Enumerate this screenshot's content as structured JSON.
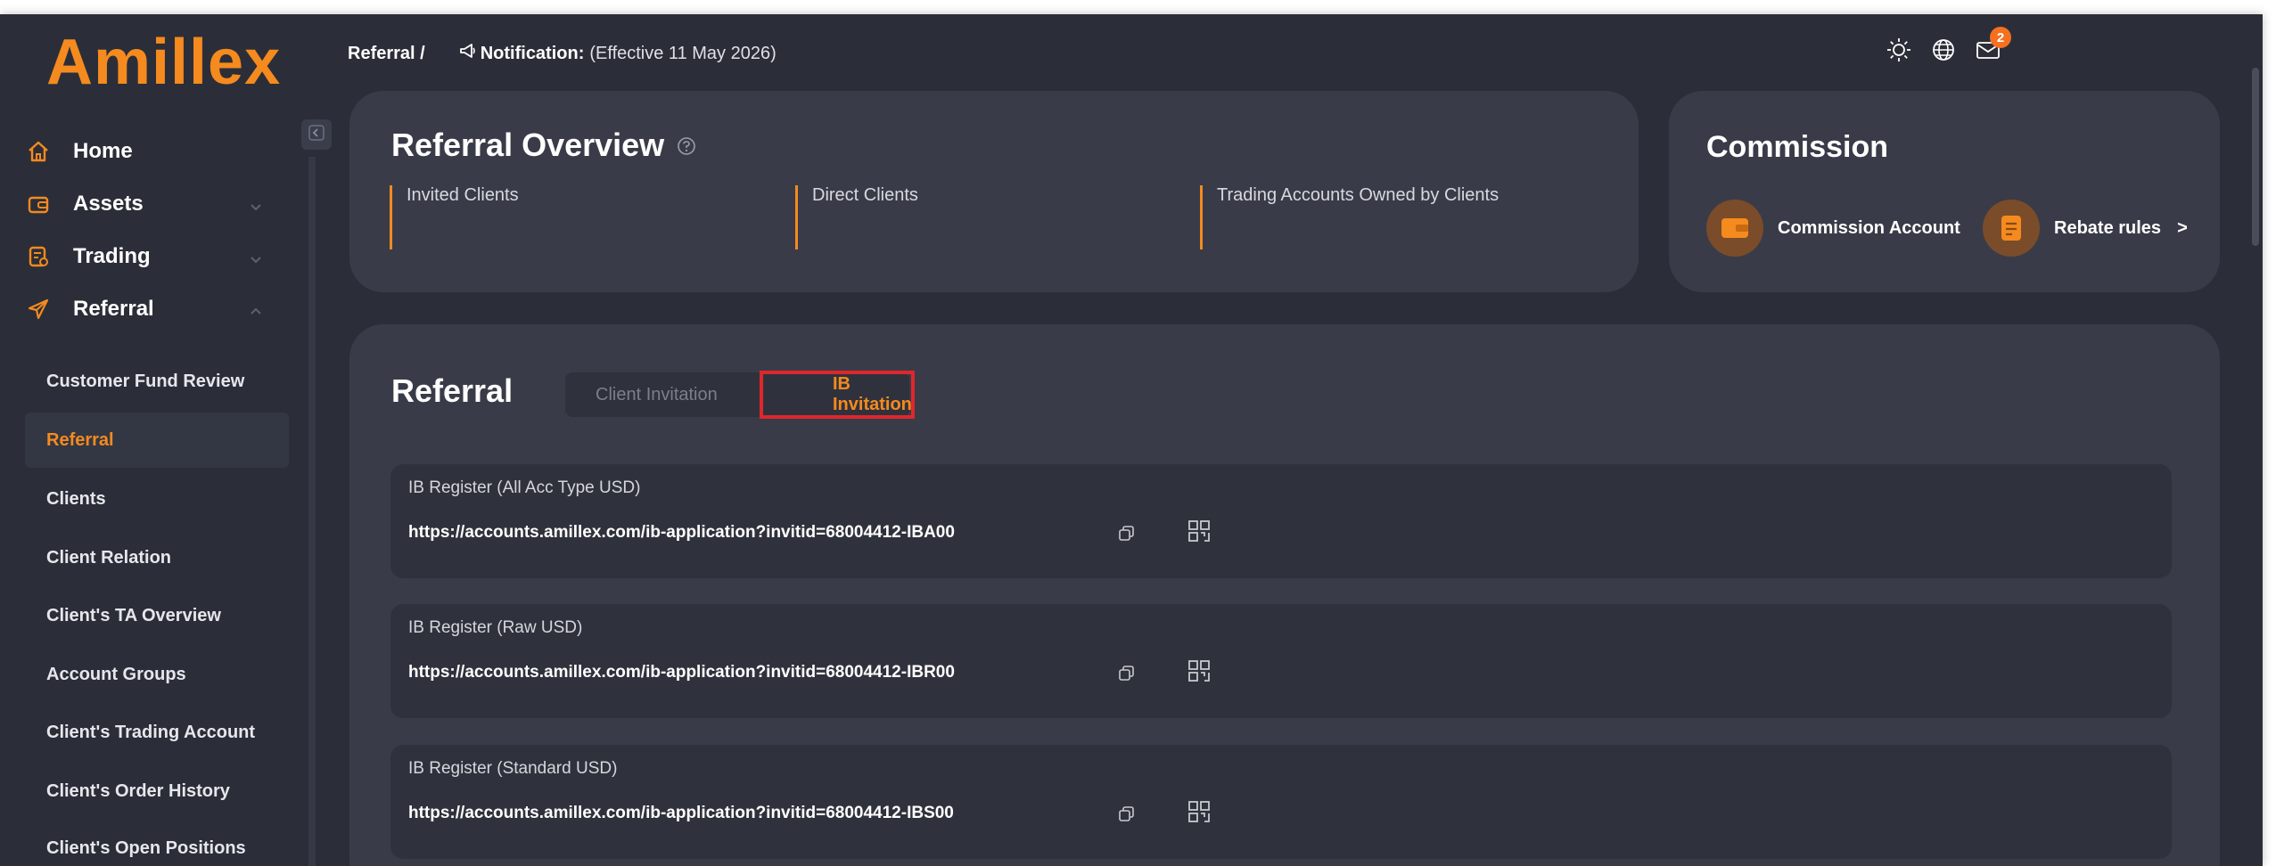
{
  "logo": "Amillex",
  "sidebar": {
    "items": [
      {
        "label": "Home",
        "icon": "home-icon"
      },
      {
        "label": "Assets",
        "icon": "wallet-icon"
      },
      {
        "label": "Trading",
        "icon": "document-icon"
      },
      {
        "label": "Referral",
        "icon": "paper-plane-icon"
      }
    ],
    "subitems": [
      "Customer Fund Review",
      "Referral",
      "Clients",
      "Client Relation",
      "Client's TA Overview",
      "Account Groups",
      "Client's Trading Account",
      "Client's Order History",
      "Client's Open Positions"
    ],
    "active_subitem": "Referral"
  },
  "topbar": {
    "breadcrumb": "Referral /",
    "notification_label": "Notification:",
    "notification_text": "(Effective 11 May 2026)",
    "mail_badge": "2"
  },
  "overview": {
    "title": "Referral Overview",
    "stats": [
      "Invited Clients",
      "Direct Clients",
      "Trading Accounts Owned by Clients"
    ]
  },
  "commission": {
    "title": "Commission",
    "account_label": "Commission Account",
    "rebate_label": "Rebate rules",
    "rebate_chevron": ">"
  },
  "referral": {
    "title": "Referral",
    "tabs": [
      "Client Invitation",
      "IB Invitation"
    ],
    "active_tab": "IB Invitation",
    "links": [
      {
        "title": "IB Register (All Acc Type USD)",
        "url": "https://accounts.amillex.com/ib-application?invitid=68004412-IBA00"
      },
      {
        "title": "IB Register (Raw USD)",
        "url": "https://accounts.amillex.com/ib-application?invitid=68004412-IBR00"
      },
      {
        "title": "IB Register (Standard USD)",
        "url": "https://accounts.amillex.com/ib-application?invitid=68004412-IBS00"
      }
    ]
  },
  "colors": {
    "accent": "#f58a1f",
    "background": "#2b2e38",
    "card": "#393c48",
    "highlight_box": "#e0262b"
  }
}
